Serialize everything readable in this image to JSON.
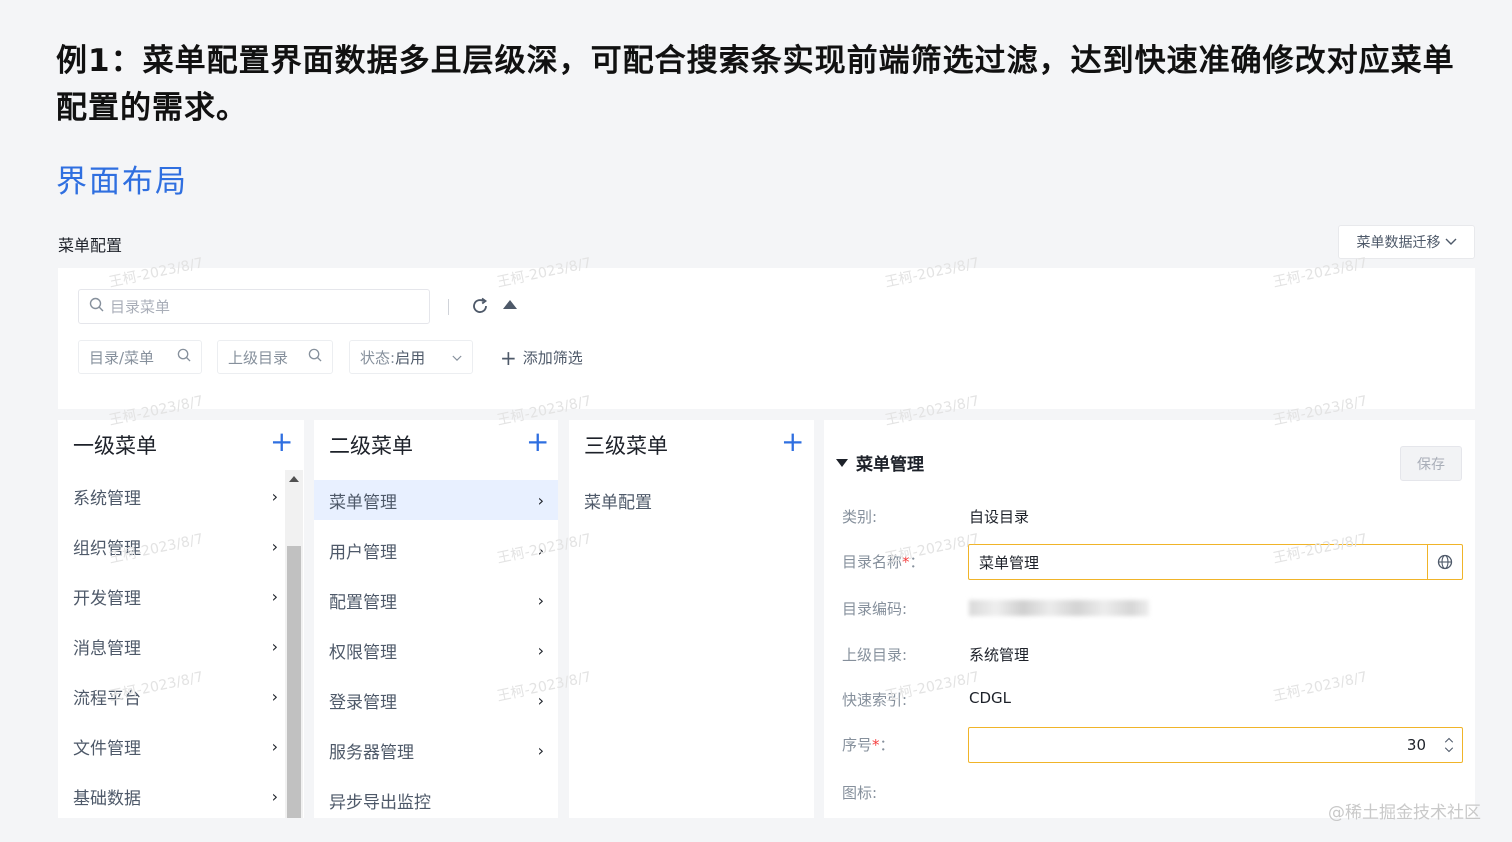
{
  "heading": "例1：菜单配置界面数据多且层级深，可配合搜索条实现前端筛选过滤，达到快速准确修改对应菜单配置的需求。",
  "subheading": "界面布局",
  "page_title": "菜单配置",
  "migrate_button": "菜单数据迁移",
  "search": {
    "placeholder": "目录菜单"
  },
  "filters": {
    "chip1": "目录/菜单",
    "chip2": "上级目录",
    "status_label": "状态:",
    "status_value": "启用",
    "add_filter": "添加筛选"
  },
  "columns": {
    "level1": {
      "title": "一级菜单",
      "items": [
        "系统管理",
        "组织管理",
        "开发管理",
        "消息管理",
        "流程平台",
        "文件管理",
        "基础数据"
      ]
    },
    "level2": {
      "title": "二级菜单",
      "items": [
        "菜单管理",
        "用户管理",
        "配置管理",
        "权限管理",
        "登录管理",
        "服务器管理",
        "异步导出监控"
      ]
    },
    "level3": {
      "title": "三级菜单",
      "items": [
        "菜单配置"
      ]
    }
  },
  "detail": {
    "title": "菜单管理",
    "save": "保存",
    "fields": {
      "category_label": "类别:",
      "category_value": "自设目录",
      "name_label": "目录名称",
      "name_colon": "：",
      "name_value": "菜单管理",
      "code_label": "目录编码:",
      "parent_label": "上级目录:",
      "parent_value": "系统管理",
      "index_label": "快速索引:",
      "index_value": "CDGL",
      "seq_label": "序号",
      "seq_colon": "：",
      "seq_value": "30",
      "icon_label": "图标:"
    }
  },
  "watermark": "王柯-2023/8/7",
  "credit": "@稀土掘金技术社区",
  "colors": {
    "accent": "#2f6fe0",
    "focus_border": "#f0b429",
    "required": "#f53f3f"
  }
}
